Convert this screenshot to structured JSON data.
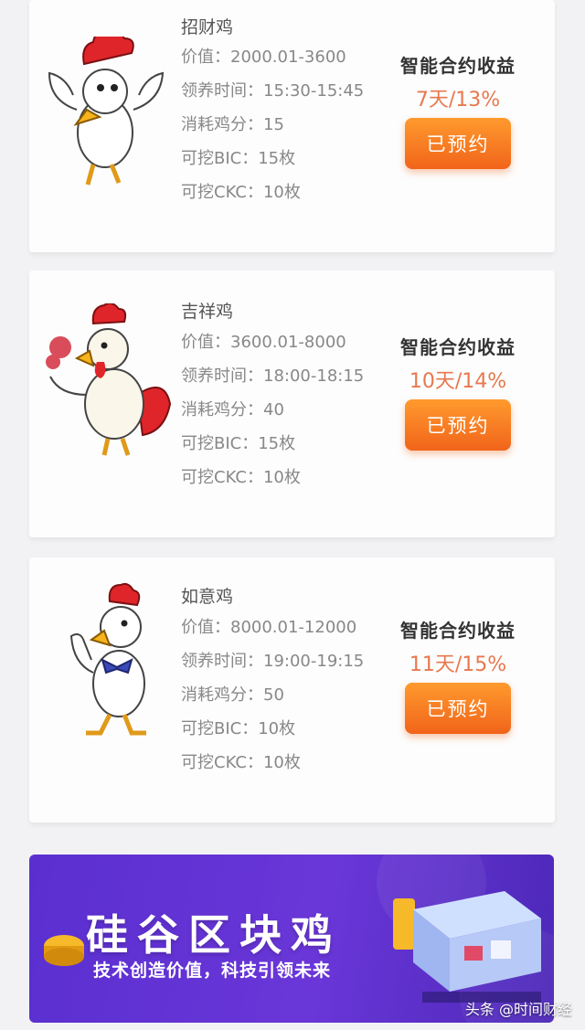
{
  "products": [
    {
      "name": "招财鸡",
      "value": "价值：2000.01-3600",
      "adopt_time": "领养时间：15:30-15:45",
      "consume": "消耗鸡分：15",
      "bic": "可挖BIC：15枚",
      "ckc": "可挖CKC：10枚",
      "contract_label": "智能合约收益",
      "ratio": "7天/13%",
      "button_label": "已预约"
    },
    {
      "name": "吉祥鸡",
      "value": "价值：3600.01-8000",
      "adopt_time": "领养时间：18:00-18:15",
      "consume": "消耗鸡分：40",
      "bic": "可挖BIC：15枚",
      "ckc": "可挖CKC：10枚",
      "contract_label": "智能合约收益",
      "ratio": "10天/14%",
      "button_label": "已预约"
    },
    {
      "name": "如意鸡",
      "value": "价值：8000.01-12000",
      "adopt_time": "领养时间：19:00-19:15",
      "consume": "消耗鸡分：50",
      "bic": "可挖BIC：10枚",
      "ckc": "可挖CKC：10枚",
      "contract_label": "智能合约收益",
      "ratio": "11天/15%",
      "button_label": "已预约"
    }
  ],
  "banner": {
    "title": "硅谷区块鸡",
    "subtitle": "技术创造价值，科技引领未来"
  },
  "watermark": "头条 @时间财经",
  "colors": {
    "accent_orange": "#f1641a",
    "ratio_color": "#e8784f",
    "banner_purple": "#5a2fd0"
  },
  "icons": [
    "chicken-mascot-icon",
    "chicken-mascot-icon",
    "chicken-mascot-icon"
  ]
}
